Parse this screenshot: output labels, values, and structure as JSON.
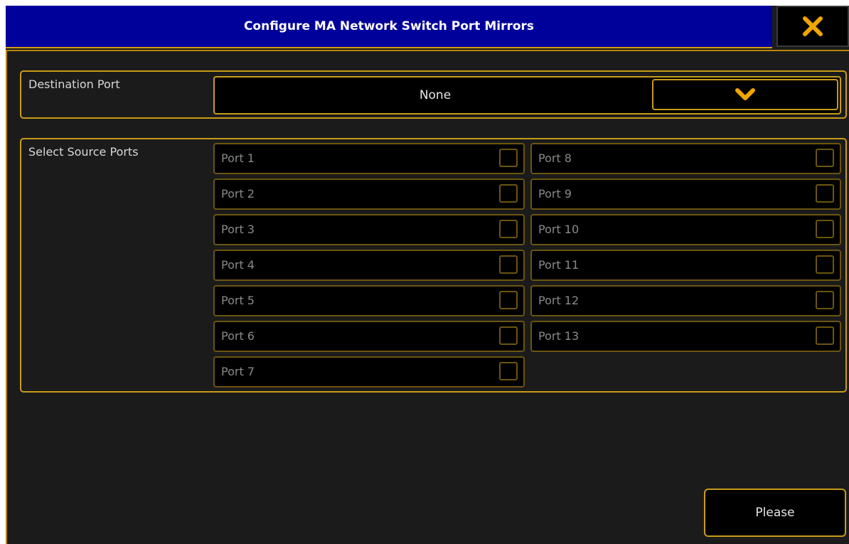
{
  "window": {
    "title": "Configure MA Network Switch Port Mirrors"
  },
  "destination": {
    "label": "Destination Port",
    "value": "None"
  },
  "source": {
    "label": "Select Source Ports",
    "ports": [
      {
        "label": "Port 1",
        "checked": false
      },
      {
        "label": "Port 2",
        "checked": false
      },
      {
        "label": "Port 3",
        "checked": false
      },
      {
        "label": "Port 4",
        "checked": false
      },
      {
        "label": "Port 5",
        "checked": false
      },
      {
        "label": "Port 6",
        "checked": false
      },
      {
        "label": "Port 7",
        "checked": false
      },
      {
        "label": "Port 8",
        "checked": false
      },
      {
        "label": "Port 9",
        "checked": false
      },
      {
        "label": "Port 10",
        "checked": false
      },
      {
        "label": "Port 11",
        "checked": false
      },
      {
        "label": "Port 12",
        "checked": false
      },
      {
        "label": "Port 13",
        "checked": false
      }
    ]
  },
  "footer": {
    "please_label": "Please"
  },
  "colors": {
    "title_bar": "#00009a",
    "accent": "#f0a500",
    "border_gold": "#c89b18",
    "background": "#1b1b1b"
  },
  "icons": {
    "close": "close-x-icon",
    "dropdown": "chevron-down-icon"
  }
}
